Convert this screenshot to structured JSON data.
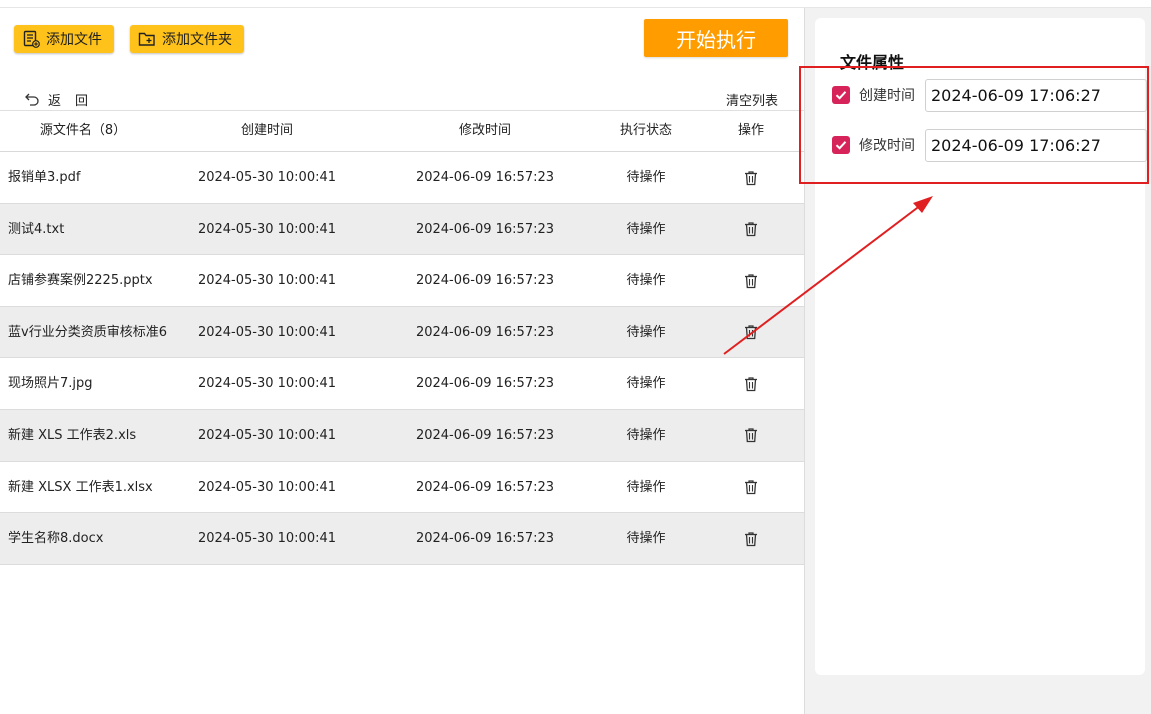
{
  "toolbar": {
    "add_file_label": "添加文件",
    "add_folder_label": "添加文件夹",
    "start_label": "开始执行",
    "back_label": "返回",
    "clear_label": "清空列表"
  },
  "table": {
    "headers": [
      "源文件名（8）",
      "创建时间",
      "修改时间",
      "执行状态",
      "操作"
    ],
    "rows": [
      {
        "name": "报销单3.pdf",
        "created": "2024-05-30 10:00:41",
        "modified": "2024-06-09 16:57:23",
        "status": "待操作"
      },
      {
        "name": "测试4.txt",
        "created": "2024-05-30 10:00:41",
        "modified": "2024-06-09 16:57:23",
        "status": "待操作"
      },
      {
        "name": "店铺参赛案例2225.pptx",
        "created": "2024-05-30 10:00:41",
        "modified": "2024-06-09 16:57:23",
        "status": "待操作"
      },
      {
        "name": "蓝v行业分类资质审核标准6",
        "created": "2024-05-30 10:00:41",
        "modified": "2024-06-09 16:57:23",
        "status": "待操作"
      },
      {
        "name": "现场照片7.jpg",
        "created": "2024-05-30 10:00:41",
        "modified": "2024-06-09 16:57:23",
        "status": "待操作"
      },
      {
        "name": "新建 XLS 工作表2.xls",
        "created": "2024-05-30 10:00:41",
        "modified": "2024-06-09 16:57:23",
        "status": "待操作"
      },
      {
        "name": "新建 XLSX 工作表1.xlsx",
        "created": "2024-05-30 10:00:41",
        "modified": "2024-06-09 16:57:23",
        "status": "待操作"
      },
      {
        "name": "学生名称8.docx",
        "created": "2024-05-30 10:00:41",
        "modified": "2024-06-09 16:57:23",
        "status": "待操作"
      }
    ]
  },
  "properties": {
    "title": "文件属性",
    "created_label": "创建时间",
    "created_value": "2024-06-09 17:06:27",
    "created_checked": true,
    "modified_label": "修改时间",
    "modified_value": "2024-06-09 17:06:27",
    "modified_checked": true
  },
  "icons": {
    "add_file": "add-file-icon",
    "add_folder": "add-folder-icon",
    "back": "back-arrow-icon",
    "delete": "trash-icon",
    "checkbox": "checkmark-icon"
  },
  "colors": {
    "button_yellow": "#ffc21a",
    "start_orange": "#ff9d00",
    "checkbox": "#d6245a",
    "annotation_red": "#e02020"
  }
}
